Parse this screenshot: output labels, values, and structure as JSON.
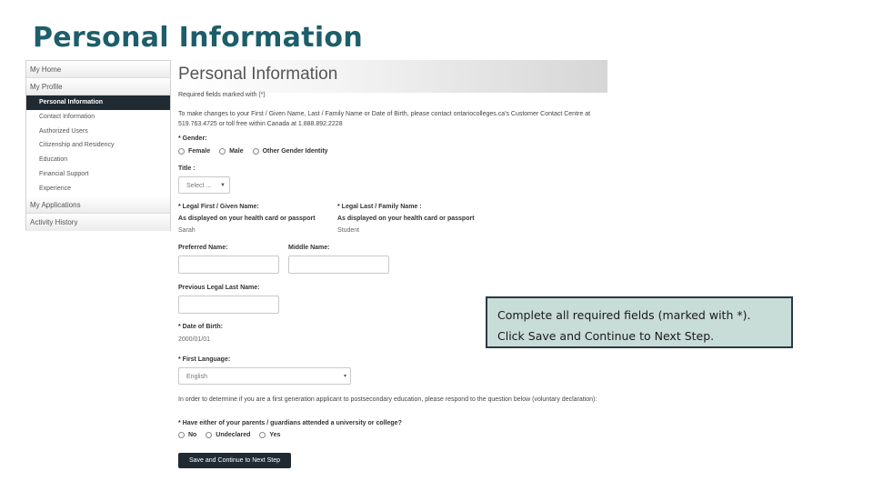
{
  "slide_title": "Personal Information",
  "sidebar": {
    "items": [
      {
        "label": "My Home"
      },
      {
        "label": "My Profile"
      }
    ],
    "sub_items": [
      {
        "label": "Personal Information",
        "active": true
      },
      {
        "label": "Contact Information"
      },
      {
        "label": "Authorized Users"
      },
      {
        "label": "Citizenship and Residency"
      },
      {
        "label": "Education"
      },
      {
        "label": "Financial Support"
      },
      {
        "label": "Experience"
      }
    ],
    "bottom_items": [
      {
        "label": "My Applications"
      },
      {
        "label": "Activity History"
      }
    ]
  },
  "form": {
    "title": "Personal Information",
    "required_note": "Required fields marked with (*)",
    "contact_note": "To make changes to your First / Given Name, Last / Family Name or Date of Birth, please contact ontariocolleges.ca's Customer Contact Centre at 519.763.4725 or toll free within Canada at 1.888.892.2228",
    "gender": {
      "label": "* Gender:",
      "options": [
        "Female",
        "Male",
        "Other Gender Identity"
      ]
    },
    "title_field": {
      "label": "Title :",
      "value": "Select ..."
    },
    "first_name": {
      "label": "* Legal First / Given Name:",
      "note": "As displayed on your health card or passport",
      "value": "Sarah"
    },
    "last_name": {
      "label": "* Legal Last / Family Name :",
      "note": "As displayed on your health card or passport",
      "value": "Student"
    },
    "preferred_name": {
      "label": "Preferred Name:",
      "value": ""
    },
    "middle_name": {
      "label": "Middle Name:",
      "value": ""
    },
    "previous_last_name": {
      "label": "Previous Legal Last Name:",
      "value": ""
    },
    "dob": {
      "label": "* Date of Birth:",
      "value": "2000/01/01"
    },
    "first_language": {
      "label": "* First Language:",
      "value": "English"
    },
    "first_gen_note": "In order to determine if you are a first generation applicant to postsecondary education, please respond to the question below (voluntary declaration):",
    "parents_question": {
      "label": "* Have either of your parents / guardians attended a university or college?",
      "options": [
        "No",
        "Undeclared",
        "Yes"
      ]
    },
    "submit_label": "Save and Continue to Next Step"
  },
  "callout": {
    "line1": "Complete all required fields (marked with *).",
    "line2": "Click Save and Continue to Next Step."
  },
  "colors": {
    "title": "#1d5e6a",
    "active_nav": "#1f2a33",
    "button": "#1f2a33",
    "callout_bg": "#c8dcd8",
    "callout_border": "#2a3a44"
  }
}
